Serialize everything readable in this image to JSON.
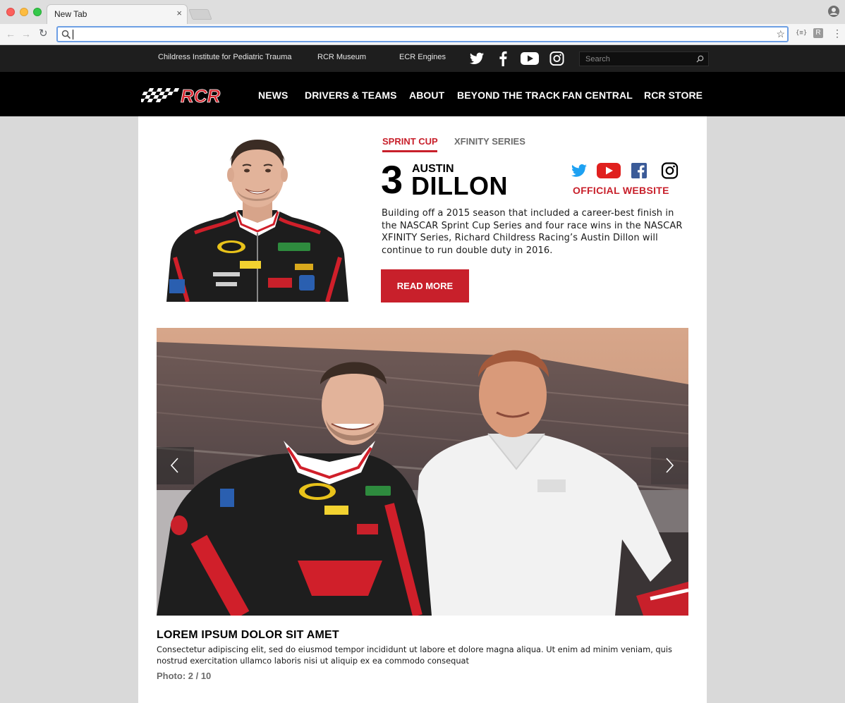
{
  "browser": {
    "tab_title": "New Tab",
    "tab_close": "×",
    "address_value": "",
    "back": "←",
    "forward": "→",
    "reload": "↻",
    "bookmark": "☆",
    "ext_label": "{≡}",
    "ext2_label": "R",
    "menu": "⋮"
  },
  "utility_bar": {
    "links": [
      "Childress Institute for Pediatric Trauma",
      "RCR Museum",
      "ECR Engines"
    ],
    "social_icons": [
      "twitter-icon",
      "facebook-icon",
      "youtube-icon",
      "instagram-icon"
    ],
    "search_placeholder": "Search"
  },
  "main_nav": {
    "logo_text": "RCR",
    "items": [
      "NEWS",
      "DRIVERS & TEAMS",
      "ABOUT",
      "BEYOND THE TRACK",
      "FAN CENTRAL",
      "RCR STORE"
    ]
  },
  "driver": {
    "series_tabs": [
      "SPRINT CUP",
      "XFINITY SERIES"
    ],
    "active_series": "SPRINT CUP",
    "number": "3",
    "first_name": "AUSTIN",
    "last_name": "DILLON",
    "social_icons": [
      "twitter-icon",
      "youtube-icon",
      "facebook-icon",
      "instagram-icon"
    ],
    "official_website": "OFFICIAL WEBSITE",
    "bio": "Building off a 2015 season that included a career-best finish in the NASCAR Sprint Cup Series and four race wins in the NASCAR XFINITY Series, Richard Childress Racing’s Austin Dillon will continue to run double duty in 2016.",
    "read_more": "READ MORE"
  },
  "gallery": {
    "caption_title": "LOREM IPSUM DOLOR SIT AMET",
    "caption_text": "Consectetur adipiscing elit, sed do eiusmod tempor incididunt ut labore et dolore magna aliqua. Ut enim ad minim veniam, quis nostrud exercitation ullamco laboris nisi ut aliquip ex ea commodo consequat",
    "counter": "Photo: 2 / 10"
  },
  "colors": {
    "brand_red": "#c8202b",
    "nav_black": "#000000",
    "utility_bar": "#1e1e1e"
  }
}
